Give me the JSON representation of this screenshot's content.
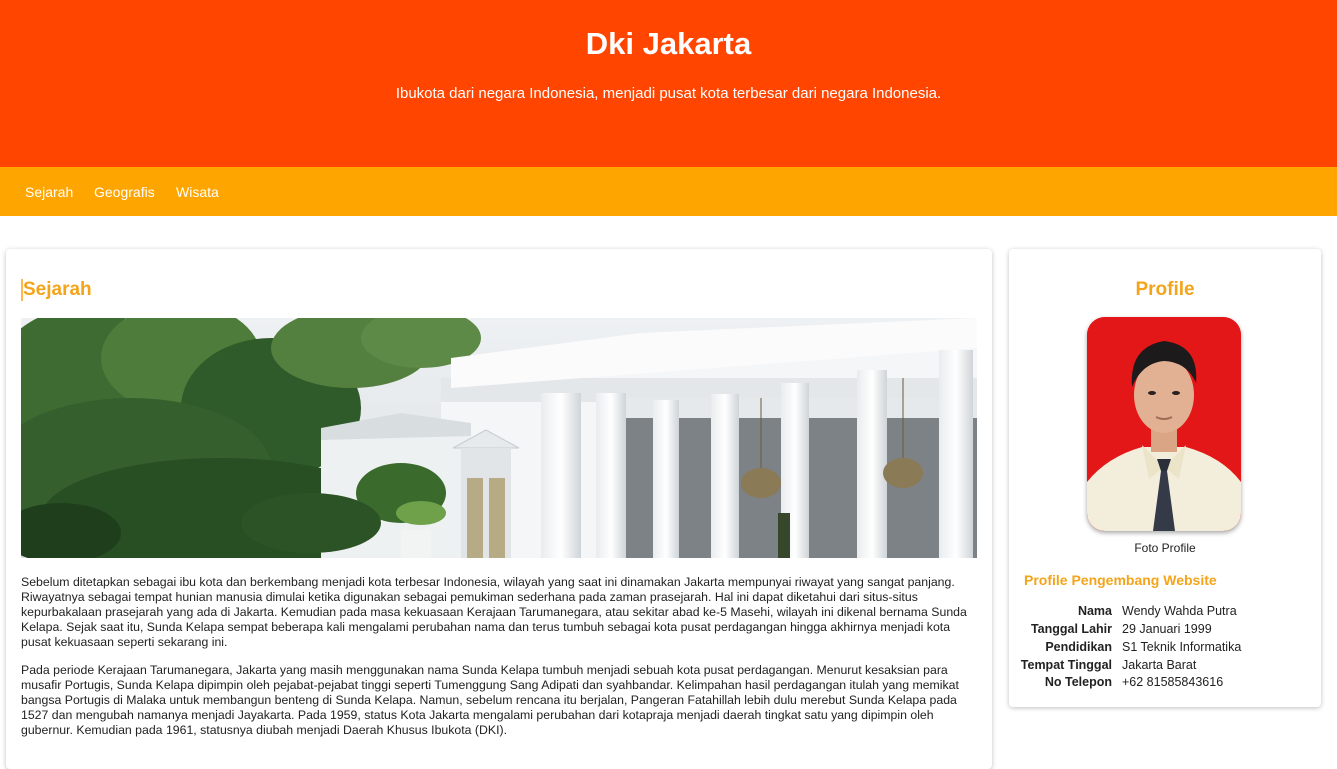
{
  "header": {
    "title": "Dki Jakarta",
    "subtitle": "Ibukota dari negara Indonesia, menjadi pusat kota terbesar dari negara Indonesia."
  },
  "nav": {
    "items": [
      "Sejarah",
      "Geografis",
      "Wisata"
    ]
  },
  "main": {
    "section_title": "Sejarah",
    "paragraphs": [
      "Sebelum ditetapkan sebagai ibu kota dan berkembang menjadi kota terbesar Indonesia, wilayah yang saat ini dinamakan Jakarta mempunyai riwayat yang sangat panjang. Riwayatnya sebagai tempat hunian manusia dimulai ketika digunakan sebagai pemukiman sederhana pada zaman prasejarah. Hal ini dapat diketahui dari situs-situs kepurbakalaan prasejarah yang ada di Jakarta. Kemudian pada masa kekuasaan Kerajaan Tarumanegara, atau sekitar abad ke-5 Masehi, wilayah ini dikenal bernama Sunda Kelapa. Sejak saat itu, Sunda Kelapa sempat beberapa kali mengalami perubahan nama dan terus tumbuh sebagai kota pusat perdagangan hingga akhirnya menjadi kota pusat kekuasaan seperti sekarang ini.",
      "Pada periode Kerajaan Tarumanegara, Jakarta yang masih menggunakan nama Sunda Kelapa tumbuh menjadi sebuah kota pusat perdagangan. Menurut kesaksian para musafir Portugis, Sunda Kelapa dipimpin oleh pejabat-pejabat tinggi seperti Tumenggung Sang Adipati dan syahbandar. Kelimpahan hasil perdagangan itulah yang memikat bangsa Portugis di Malaka untuk membangun benteng di Sunda Kelapa. Namun, sebelum rencana itu berjalan, Pangeran Fatahillah lebih dulu merebut Sunda Kelapa pada 1527 dan mengubah namanya menjadi Jayakarta. Pada 1959, status Kota Jakarta mengalami perubahan dari kotapraja menjadi daerah tingkat satu yang dipimpin oleh gubernur. Kemudian pada 1961, statusnya diubah menjadi Daerah Khusus Ibukota (DKI)."
    ]
  },
  "sidebar": {
    "title": "Profile",
    "photo_caption": "Foto Profile",
    "dev_title": "Profile Pengembang Website",
    "info": [
      {
        "label": "Nama",
        "value": "Wendy Wahda Putra"
      },
      {
        "label": "Tanggal Lahir",
        "value": "29 Januari 1999"
      },
      {
        "label": "Pendidikan",
        "value": "S1 Teknik Informatika"
      },
      {
        "label": "Tempat Tinggal",
        "value": "Jakarta Barat"
      },
      {
        "label": "No Telepon",
        "value": "+62 81585843616"
      }
    ]
  },
  "colors": {
    "header": "#ff4500",
    "nav": "#ffa500",
    "accent": "#f4a41a"
  }
}
